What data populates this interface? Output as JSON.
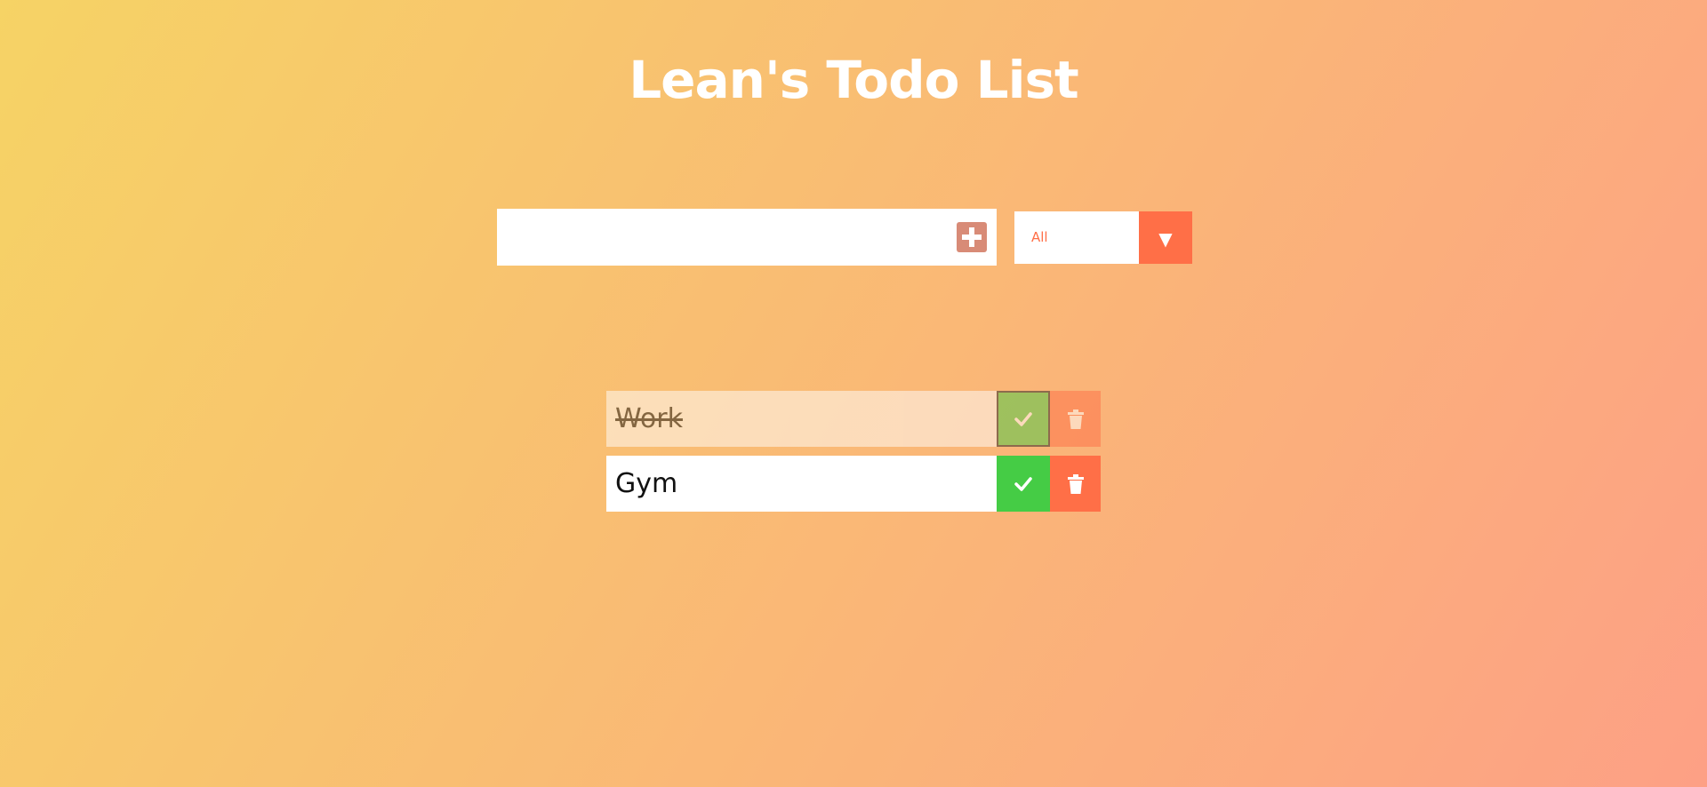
{
  "header": {
    "title": "Lean's Todo List"
  },
  "add_form": {
    "input_value": "",
    "placeholder": "",
    "add_icon": "plus-square-icon"
  },
  "filter": {
    "selected": "All",
    "arrow_icon": "triangle-down-icon"
  },
  "todos": [
    {
      "text": "Work",
      "completed": true,
      "check_icon": "check-icon",
      "trash_icon": "trash-icon"
    },
    {
      "text": "Gym",
      "completed": false,
      "check_icon": "check-icon",
      "trash_icon": "trash-icon"
    }
  ],
  "colors": {
    "gradient_start": "#f6d365",
    "gradient_end": "#fda085",
    "accent": "#ff6f47",
    "complete": "#45cc45",
    "add_button": "#d88b77"
  }
}
